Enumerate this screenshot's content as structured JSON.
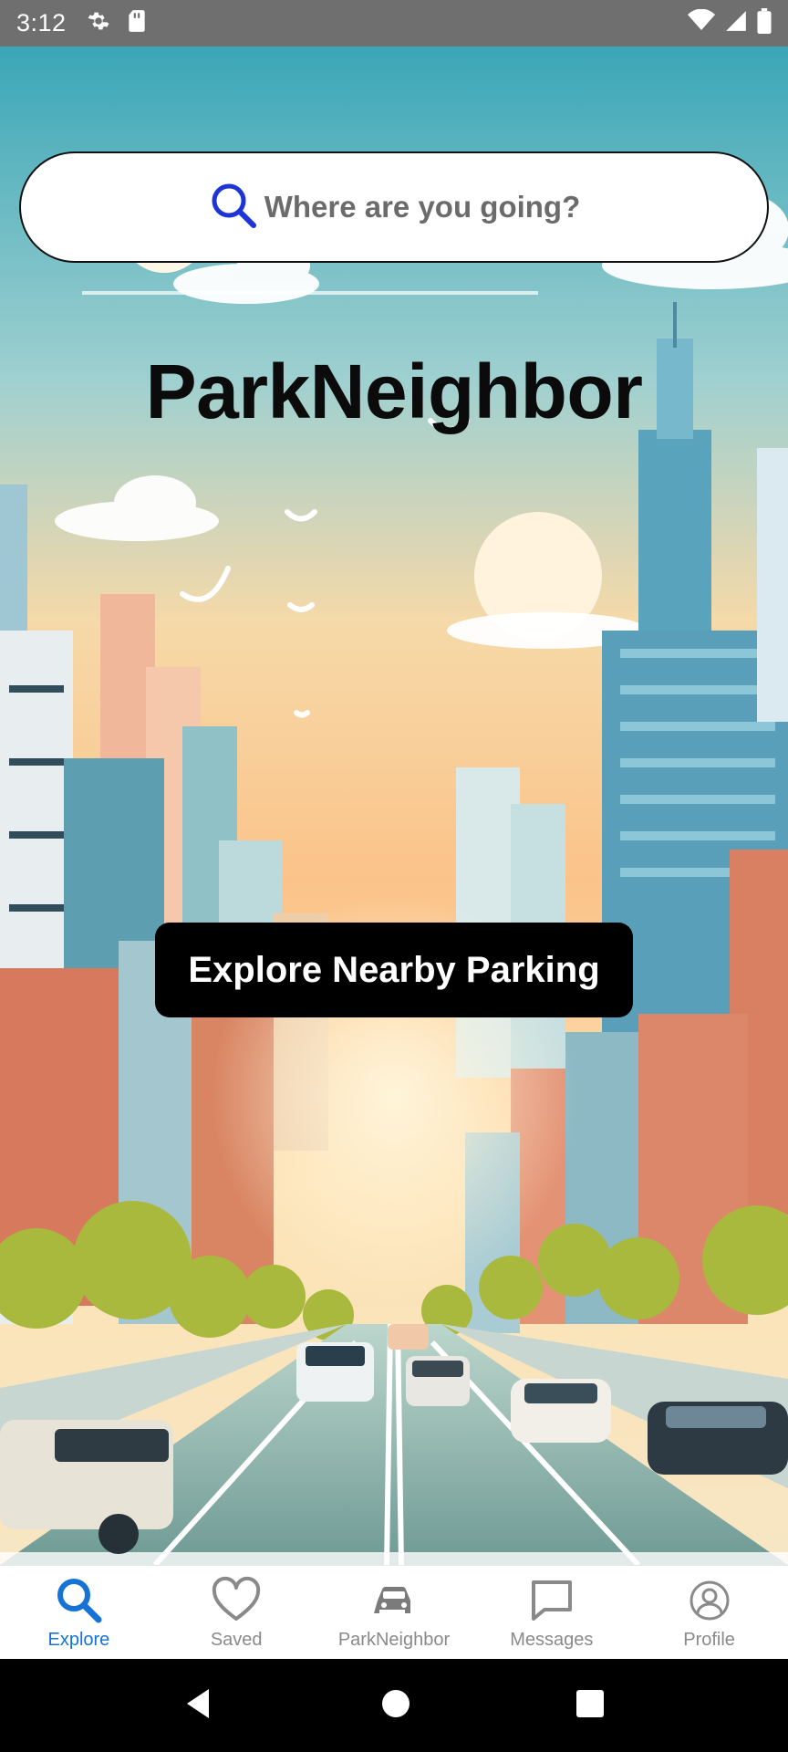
{
  "status_bar": {
    "time": "3:12",
    "left_icons": [
      "gear-icon",
      "sd-card-icon"
    ],
    "right_icons": [
      "wifi-icon",
      "signal-icon",
      "battery-icon"
    ]
  },
  "search": {
    "placeholder": "Where are you going?",
    "icon": "search-icon",
    "icon_color": "#1d34d9"
  },
  "hero": {
    "title": "ParkNeighbor",
    "cta_label": "Explore Nearby Parking"
  },
  "bottom_nav": {
    "active_color": "#1673d6",
    "inactive_color": "#8a8a8a",
    "items": [
      {
        "label": "Explore",
        "icon": "search-icon",
        "active": true
      },
      {
        "label": "Saved",
        "icon": "heart-icon",
        "active": false
      },
      {
        "label": "ParkNeighbor",
        "icon": "car-icon",
        "active": false
      },
      {
        "label": "Messages",
        "icon": "chat-bubble-icon",
        "active": false
      },
      {
        "label": "Profile",
        "icon": "user-circle-icon",
        "active": false
      }
    ]
  },
  "system_nav": {
    "icons": [
      "back-icon",
      "home-icon",
      "recents-icon"
    ]
  }
}
